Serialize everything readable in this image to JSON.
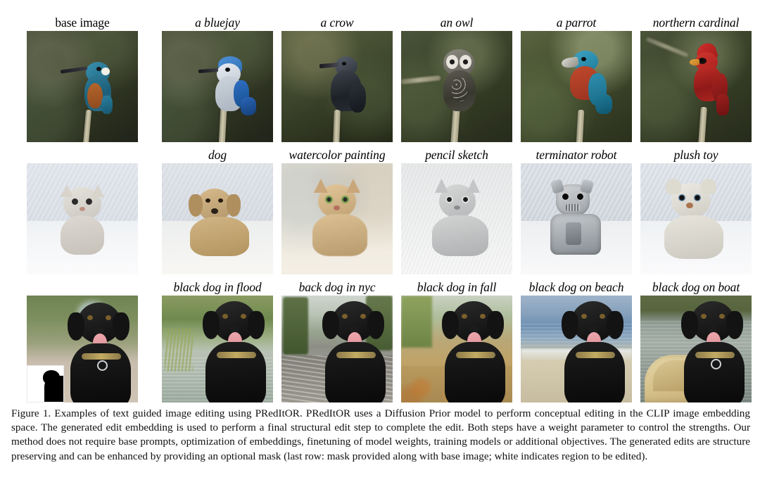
{
  "figure": {
    "rows": [
      {
        "id": "row-birds",
        "cells": [
          {
            "label": "base image",
            "style": "plain",
            "kind": "kingfisher",
            "mask": false
          },
          {
            "label": "a bluejay",
            "style": "italic",
            "kind": "bluejay",
            "mask": false
          },
          {
            "label": "a crow",
            "style": "italic",
            "kind": "crow",
            "mask": false
          },
          {
            "label": "an owl",
            "style": "italic",
            "kind": "owl",
            "mask": false
          },
          {
            "label": "a parrot",
            "style": "italic",
            "kind": "parrot",
            "mask": false
          },
          {
            "label": "northern cardinal",
            "style": "italic",
            "kind": "cardinal",
            "mask": false
          }
        ]
      },
      {
        "id": "row-cat",
        "cells": [
          {
            "label": "",
            "style": "plain",
            "kind": "kitten",
            "mask": false
          },
          {
            "label": "dog",
            "style": "italic",
            "kind": "golden-dog",
            "mask": false
          },
          {
            "label": "watercolor painting",
            "style": "italic",
            "kind": "watercolor-cat",
            "mask": false
          },
          {
            "label": "pencil sketch",
            "style": "italic",
            "kind": "sketch-cat",
            "mask": false
          },
          {
            "label": "terminator robot",
            "style": "italic",
            "kind": "robot-cat",
            "mask": false
          },
          {
            "label": "plush toy",
            "style": "italic",
            "kind": "plush-cat",
            "mask": false
          }
        ]
      },
      {
        "id": "row-black-dog",
        "cells": [
          {
            "label": "",
            "style": "plain",
            "kind": "black-dog-base",
            "mask": true
          },
          {
            "label": "black dog in flood",
            "style": "italic",
            "kind": "black-dog-flood",
            "mask": false
          },
          {
            "label": "back dog in nyc",
            "style": "italic",
            "kind": "black-dog-nyc",
            "mask": false
          },
          {
            "label": "black dog in fall",
            "style": "italic",
            "kind": "black-dog-fall",
            "mask": false
          },
          {
            "label": "black dog on beach",
            "style": "italic",
            "kind": "black-dog-beach",
            "mask": false
          },
          {
            "label": "black dog on boat",
            "style": "italic",
            "kind": "black-dog-boat",
            "mask": false
          }
        ]
      }
    ]
  },
  "caption": {
    "text": "Figure 1. Examples of text guided image editing using PRedItOR. PRedItOR uses a Diffusion Prior model to perform conceptual editing in the CLIP image embedding space. The generated edit embedding is used to perform a final structural edit step to complete the edit. Both steps have a weight parameter to control the strengths. Our method does not require base prompts, optimization of embeddings, finetuning of model weights, training models or additional objectives. The generated edits are structure preserving and can be enhanced by providing an optional mask (last row: mask provided along with base image; white indicates region to be edited)."
  },
  "labels": {
    "row1": [
      "base image",
      "a bluejay",
      "a crow",
      "an owl",
      "a parrot",
      "northern cardinal"
    ],
    "row2": [
      "dog",
      "watercolor painting",
      "pencil sketch",
      "terminator robot",
      "plush toy"
    ],
    "row3": [
      "black dog in flood",
      "back dog in nyc",
      "black dog in fall",
      "black dog on beach",
      "black dog on boat"
    ]
  },
  "colors": {
    "page_background": "#ffffff",
    "text": "#000000",
    "mask_foreground": "#000000",
    "mask_background": "#ffffff"
  }
}
